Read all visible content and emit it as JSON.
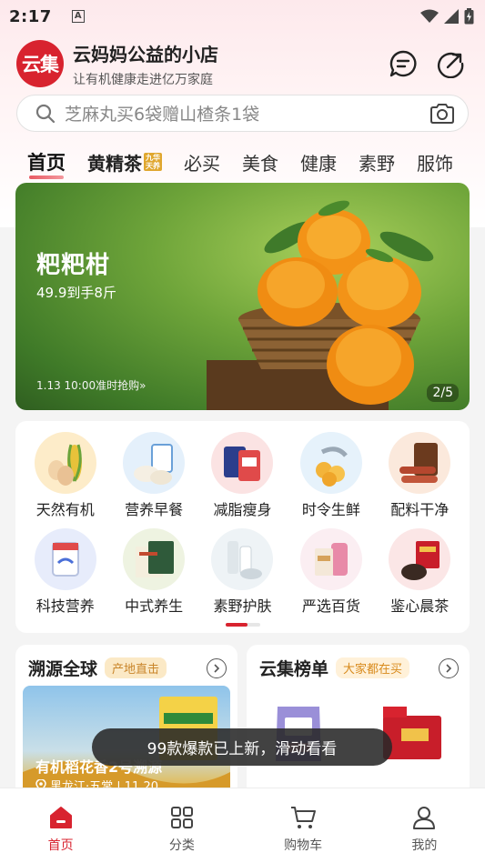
{
  "status_bar": {
    "time": "2:17",
    "notif_letter": "A"
  },
  "header": {
    "logo_text": "云集",
    "shop_name": "云妈妈公益的小店",
    "slogan": "让有机健康走进亿万家庭",
    "message_icon": "message-icon",
    "share_icon": "share-icon"
  },
  "search": {
    "placeholder": "芝麻丸买6袋赠山楂条1袋",
    "icon": "search-icon",
    "camera_icon": "camera-icon"
  },
  "tabs": [
    {
      "label": "首页",
      "active": true
    },
    {
      "label": "黄精茶",
      "badge_top": "九华",
      "badge_bottom": "天养"
    },
    {
      "label": "必买"
    },
    {
      "label": "美食"
    },
    {
      "label": "健康"
    },
    {
      "label": "素野"
    },
    {
      "label": "服饰"
    }
  ],
  "banner": {
    "title": "粑粑柑",
    "subtitle": "49.9到手8斤",
    "note": "1.13 10:00准时抢购»",
    "page_indicator": "2/5"
  },
  "categories": [
    {
      "label": "天然有机",
      "icon": "eggs-corn-icon",
      "bg": "#fdecc9"
    },
    {
      "label": "营养早餐",
      "icon": "buns-icon",
      "bg": "#e4f0fb"
    },
    {
      "label": "减脂瘦身",
      "icon": "diet-pack-icon",
      "bg": "#fbe3e3"
    },
    {
      "label": "时令生鲜",
      "icon": "seafood-icon",
      "bg": "#e6f2fb"
    },
    {
      "label": "配料干净",
      "icon": "sausage-icon",
      "bg": "#fbe9dc"
    },
    {
      "label": "科技营养",
      "icon": "supplement-icon",
      "bg": "#e7ecfb"
    },
    {
      "label": "中式养生",
      "icon": "herbal-box-icon",
      "bg": "#eef3e1"
    },
    {
      "label": "素野护肤",
      "icon": "skincare-icon",
      "bg": "#eef3f6"
    },
    {
      "label": "严选百货",
      "icon": "detergent-icon",
      "bg": "#fbeef2"
    },
    {
      "label": "鉴心晨茶",
      "icon": "tea-gift-icon",
      "bg": "#fbe6e6"
    }
  ],
  "cards": {
    "left": {
      "title": "溯源全球",
      "tag": "产地直击",
      "visual_title": "有机稻花香2号溯源",
      "visual_location": "黑龙江·五常 | 11.20"
    },
    "right": {
      "title": "云集榜单",
      "tag": "大家都在买"
    }
  },
  "toast": "99款爆款已上新，滑动看看",
  "bottom_nav": [
    {
      "label": "首页",
      "icon": "home-icon",
      "active": true
    },
    {
      "label": "分类",
      "icon": "grid-icon"
    },
    {
      "label": "购物车",
      "icon": "cart-icon"
    },
    {
      "label": "我的",
      "icon": "user-icon"
    }
  ],
  "colors": {
    "brand": "#d8232f",
    "tag_bg": "#fbe9c6",
    "tag_text": "#c9852a"
  }
}
